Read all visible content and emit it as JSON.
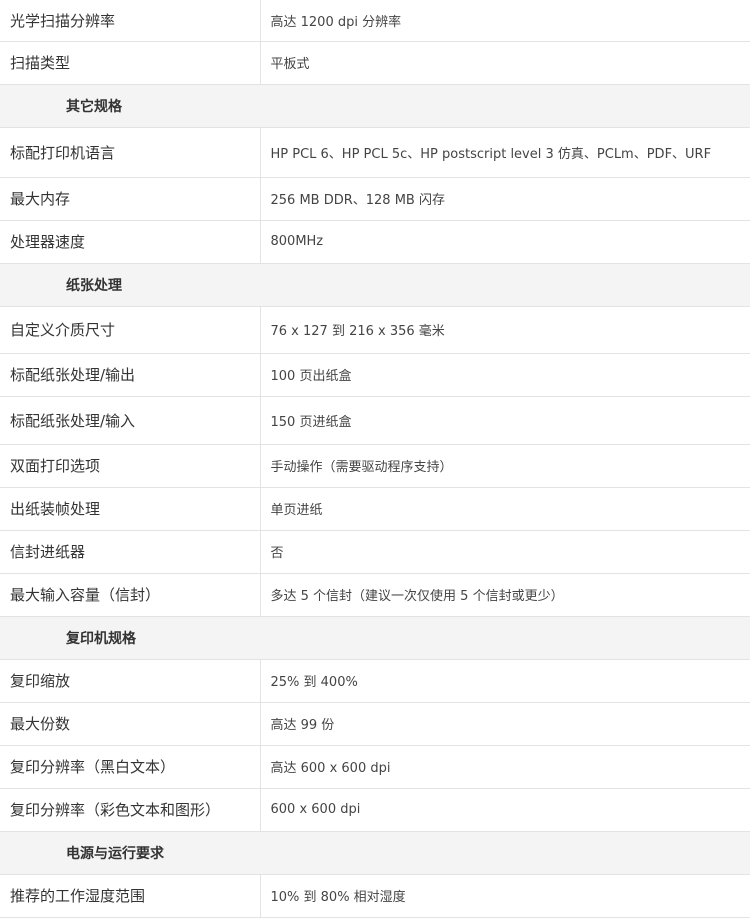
{
  "rows": [
    {
      "kind": "spec",
      "label": "光学扫描分辨率",
      "value": "高达 1200 dpi 分辨率",
      "h": 41
    },
    {
      "kind": "spec",
      "label": "扫描类型",
      "value": "平板式",
      "h": 43
    },
    {
      "kind": "section",
      "label": "其它规格",
      "h": 43
    },
    {
      "kind": "spec",
      "label": "标配打印机语言",
      "value": "HP PCL 6、HP PCL 5c、HP postscript level 3 仿真、PCLm、PDF、URF",
      "h": 50
    },
    {
      "kind": "spec",
      "label": "最大内存",
      "value": "256 MB DDR、128 MB 闪存",
      "h": 43
    },
    {
      "kind": "spec",
      "label": "处理器速度",
      "value": "800MHz",
      "h": 43
    },
    {
      "kind": "section",
      "label": "纸张处理",
      "h": 43
    },
    {
      "kind": "spec",
      "label": "自定义介质尺寸",
      "value": "76 x 127 到 216 x 356 毫米",
      "h": 47
    },
    {
      "kind": "spec",
      "label": "标配纸张处理/输出",
      "value": "100 页出纸盒",
      "h": 43
    },
    {
      "kind": "spec",
      "label": "标配纸张处理/输入",
      "value": "150 页进纸盒",
      "h": 48
    },
    {
      "kind": "spec",
      "label": "双面打印选项",
      "value": "手动操作（需要驱动程序支持）",
      "h": 43
    },
    {
      "kind": "spec",
      "label": "出纸装帧处理",
      "value": "单页进纸",
      "h": 43
    },
    {
      "kind": "spec",
      "label": "信封进纸器",
      "value": "否",
      "h": 43
    },
    {
      "kind": "spec",
      "label": "最大输入容量（信封）",
      "value": "多达 5 个信封（建议一次仅使用 5 个信封或更少）",
      "h": 43
    },
    {
      "kind": "section",
      "label": "复印机规格",
      "h": 43
    },
    {
      "kind": "spec",
      "label": "复印缩放",
      "value": "25% 到 400%",
      "h": 43
    },
    {
      "kind": "spec",
      "label": "最大份数",
      "value": "高达 99 份",
      "h": 43
    },
    {
      "kind": "spec",
      "label": "复印分辨率（黑白文本）",
      "value": "高达 600 x 600 dpi",
      "h": 43
    },
    {
      "kind": "spec",
      "label": "复印分辨率（彩色文本和图形）",
      "value": "600 x 600 dpi",
      "h": 43
    },
    {
      "kind": "section",
      "label": "电源与运行要求",
      "h": 43
    },
    {
      "kind": "spec",
      "label": "推荐的工作湿度范围",
      "value": "10% 到 80% 相对湿度",
      "h": 43
    }
  ]
}
